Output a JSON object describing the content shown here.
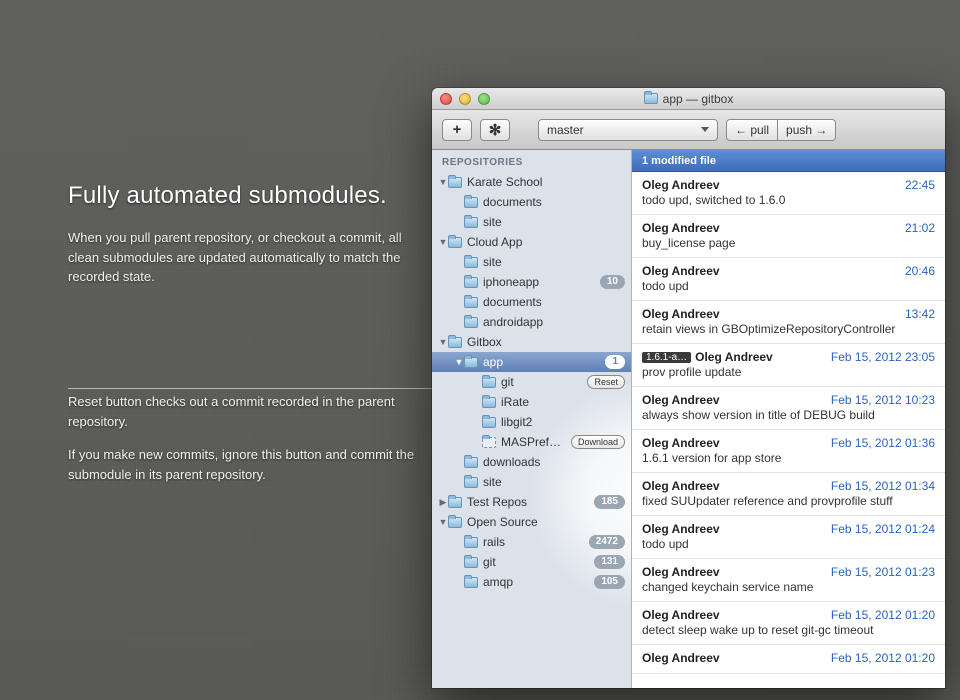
{
  "marketing": {
    "headline": "Fully automated submodules.",
    "para": "When you pull parent repository, or checkout a commit, all clean submodules are updated automatically to match the recorded state."
  },
  "callout": {
    "p1": "Reset button checks out a commit recorded in the parent repository.",
    "p2": "If you make new commits, ignore this button and commit the submodule in its parent repository."
  },
  "window": {
    "title": "app — gitbox",
    "toolbar": {
      "add_label": "+",
      "gear_label": "✻",
      "branch": "master",
      "pull_label": "← pull",
      "push_label": "push →"
    }
  },
  "sidebar": {
    "header": "REPOSITORIES",
    "reset_label": "Reset",
    "download_label": "Download",
    "tree": [
      {
        "level": 0,
        "exp": "down",
        "kind": "folder",
        "label": "Karate School"
      },
      {
        "level": 1,
        "exp": "",
        "kind": "folder",
        "label": "documents"
      },
      {
        "level": 1,
        "exp": "",
        "kind": "folder",
        "label": "site"
      },
      {
        "level": 0,
        "exp": "down",
        "kind": "folder",
        "label": "Cloud App"
      },
      {
        "level": 1,
        "exp": "",
        "kind": "folder",
        "label": "site"
      },
      {
        "level": 1,
        "exp": "",
        "kind": "folder",
        "label": "iphoneapp",
        "badge": "10"
      },
      {
        "level": 1,
        "exp": "",
        "kind": "folder",
        "label": "documents"
      },
      {
        "level": 1,
        "exp": "",
        "kind": "folder",
        "label": "androidapp"
      },
      {
        "level": 0,
        "exp": "down",
        "kind": "folder",
        "label": "Gitbox"
      },
      {
        "level": 1,
        "exp": "down",
        "kind": "folder",
        "label": "app",
        "badge": "1",
        "selected": true
      },
      {
        "level": 2,
        "exp": "",
        "kind": "folder",
        "label": "git",
        "action": "reset"
      },
      {
        "level": 2,
        "exp": "",
        "kind": "folder",
        "label": "iRate"
      },
      {
        "level": 2,
        "exp": "",
        "kind": "folder",
        "label": "libgit2"
      },
      {
        "level": 2,
        "exp": "",
        "kind": "dashed",
        "label": "MASPref…",
        "action": "download"
      },
      {
        "level": 1,
        "exp": "",
        "kind": "folder",
        "label": "downloads"
      },
      {
        "level": 1,
        "exp": "",
        "kind": "folder",
        "label": "site"
      },
      {
        "level": 0,
        "exp": "right",
        "kind": "folder",
        "label": "Test Repos",
        "badge": "185"
      },
      {
        "level": 0,
        "exp": "down",
        "kind": "folder",
        "label": "Open Source"
      },
      {
        "level": 1,
        "exp": "",
        "kind": "folder",
        "label": "rails",
        "badge": "2472"
      },
      {
        "level": 1,
        "exp": "",
        "kind": "folder",
        "label": "git",
        "badge": "131"
      },
      {
        "level": 1,
        "exp": "",
        "kind": "folder",
        "label": "amqp",
        "badge": "105"
      }
    ]
  },
  "status": {
    "text": "1 modified file"
  },
  "commits": [
    {
      "author": "Oleg Andreev",
      "msg": "todo upd, switched to 1.6.0",
      "time": "22:45"
    },
    {
      "author": "Oleg Andreev",
      "msg": "buy_license page",
      "time": "21:02"
    },
    {
      "author": "Oleg Andreev",
      "msg": "todo upd",
      "time": "20:46"
    },
    {
      "author": "Oleg Andreev",
      "msg": "retain views in GBOptimizeRepositoryController",
      "time": "13:42"
    },
    {
      "author": "Oleg Andreev",
      "msg": "prov profile update",
      "time": "Feb 15, 2012 23:05",
      "tag": "1.6.1-a…"
    },
    {
      "author": "Oleg Andreev",
      "msg": "always show version in title of DEBUG build",
      "time": "Feb 15, 2012 10:23"
    },
    {
      "author": "Oleg Andreev",
      "msg": "1.6.1 version for app store",
      "time": "Feb 15, 2012 01:36"
    },
    {
      "author": "Oleg Andreev",
      "msg": "fixed SUUpdater reference and provprofile stuff",
      "time": "Feb 15, 2012 01:34"
    },
    {
      "author": "Oleg Andreev",
      "msg": "todo upd",
      "time": "Feb 15, 2012 01:24"
    },
    {
      "author": "Oleg Andreev",
      "msg": "changed keychain service name",
      "time": "Feb 15, 2012 01:23"
    },
    {
      "author": "Oleg Andreev",
      "msg": "detect sleep wake up to reset git-gc timeout",
      "time": "Feb 15, 2012 01:20"
    },
    {
      "author": "Oleg Andreev",
      "msg": "",
      "time": "Feb 15, 2012 01:20"
    }
  ]
}
